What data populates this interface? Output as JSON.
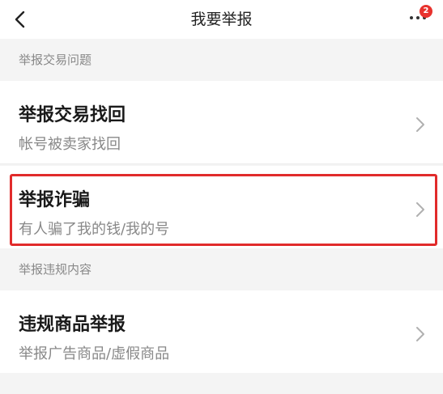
{
  "header": {
    "title": "我要举报",
    "back_icon": "chevron-left-icon",
    "more_icon": "more-horizontal-icon",
    "notification_count": "2"
  },
  "colors": {
    "badge": "#e8322d",
    "highlight_border": "#e12b2b",
    "background": "#f4f4f4"
  },
  "sections": [
    {
      "header": "举报交易问题",
      "items": [
        {
          "title": "举报交易找回",
          "subtitle": "帐号被卖家找回"
        },
        {
          "title": "举报诈骗",
          "subtitle": "有人骗了我的钱/我的号",
          "highlighted": true
        }
      ]
    },
    {
      "header": "举报违规内容",
      "items": [
        {
          "title": "违规商品举报",
          "subtitle": "举报广告商品/虚假商品"
        }
      ]
    }
  ]
}
